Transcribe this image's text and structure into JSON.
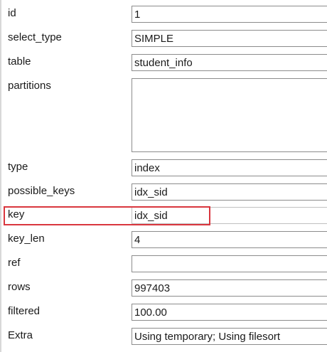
{
  "rows": [
    {
      "label": "id",
      "value": "1"
    },
    {
      "label": "select_type",
      "value": "SIMPLE"
    },
    {
      "label": "table",
      "value": "student_info"
    },
    {
      "label": "partitions",
      "value": ""
    },
    {
      "label": "type",
      "value": "index"
    },
    {
      "label": "possible_keys",
      "value": "idx_sid"
    },
    {
      "label": "key",
      "value": "idx_sid"
    },
    {
      "label": "key_len",
      "value": "4"
    },
    {
      "label": "ref",
      "value": ""
    },
    {
      "label": "rows",
      "value": "997403"
    },
    {
      "label": "filtered",
      "value": "100.00"
    },
    {
      "label": "Extra",
      "value": "Using temporary; Using filesort"
    }
  ],
  "colors": {
    "highlight": "#d9363e",
    "field_border": "#8c8c8c"
  }
}
